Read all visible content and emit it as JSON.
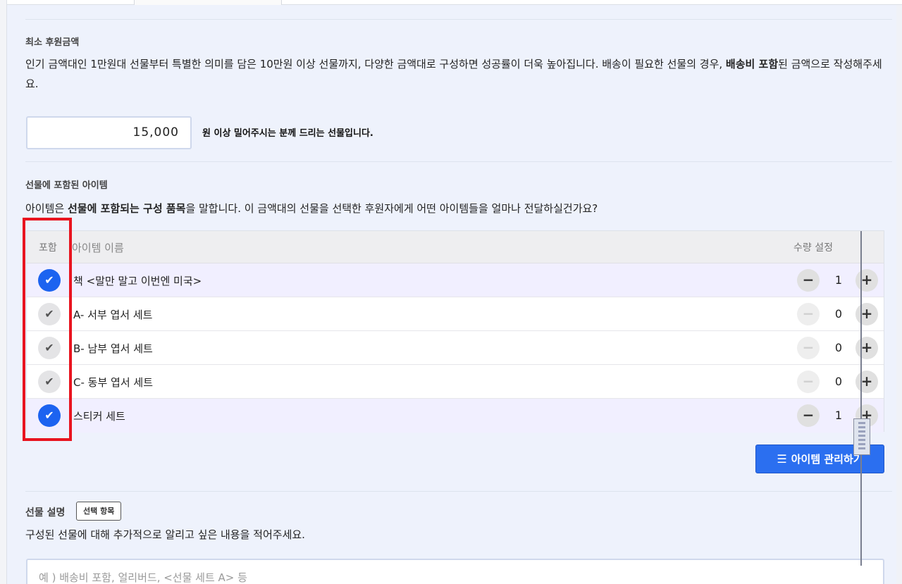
{
  "min_amount": {
    "title": "최소 후원금액",
    "desc_part1": "인기 금액대인 1만원대 선물부터 특별한 의미를 담은 10만원 이상 선물까지, 다양한 금액대로 구성하면 성공률이 더욱 높아집니다. 배송이 필요한 선물의 경우, ",
    "desc_bold": "배송비 포함",
    "desc_part2": "된 금액으로 작성해주세요.",
    "value": "15,000",
    "suffix": "원 이상 밀어주시는 분께 드리는 선물입니다."
  },
  "items_section": {
    "title": "선물에 포함된 아이템",
    "desc_part1": "아이템은 ",
    "desc_bold": "선물에 포함되는 구성 품목",
    "desc_part2": "을 말합니다. 이 금액대의 선물을 선택한 후원자에게 어떤 아이템들을 얼마나 전달하실건가요?",
    "header": {
      "include": "포함",
      "name": "아이템 이름",
      "quantity": "수량 설정"
    },
    "rows": [
      {
        "name": "책 <말만 말고 이번엔 미국>",
        "qty": "1",
        "included": true
      },
      {
        "name": "A- 서부 엽서 세트",
        "qty": "0",
        "included": false
      },
      {
        "name": "B- 남부 엽서 세트",
        "qty": "0",
        "included": false
      },
      {
        "name": "C- 동부 엽서 세트",
        "qty": "0",
        "included": false
      },
      {
        "name": "스티커 세트",
        "qty": "1",
        "included": true
      }
    ],
    "manage_button": "아이템 관리하기"
  },
  "gift_desc": {
    "title": "선물 설명",
    "badge": "선택 항목",
    "desc": "구성된 선물에 대해 추가적으로 알리고 싶은 내용을 적어주세요.",
    "placeholder": "예 ) 배송비 포함, 얼리버드, <선물 세트 A> 등"
  },
  "icons": {
    "check": "check-icon",
    "minus": "minus-icon",
    "plus": "plus-icon",
    "list": "list-icon"
  },
  "colors": {
    "accent": "#2b6ff0",
    "highlight_border": "#e8141f",
    "checked_row_bg": "#f1efff"
  }
}
